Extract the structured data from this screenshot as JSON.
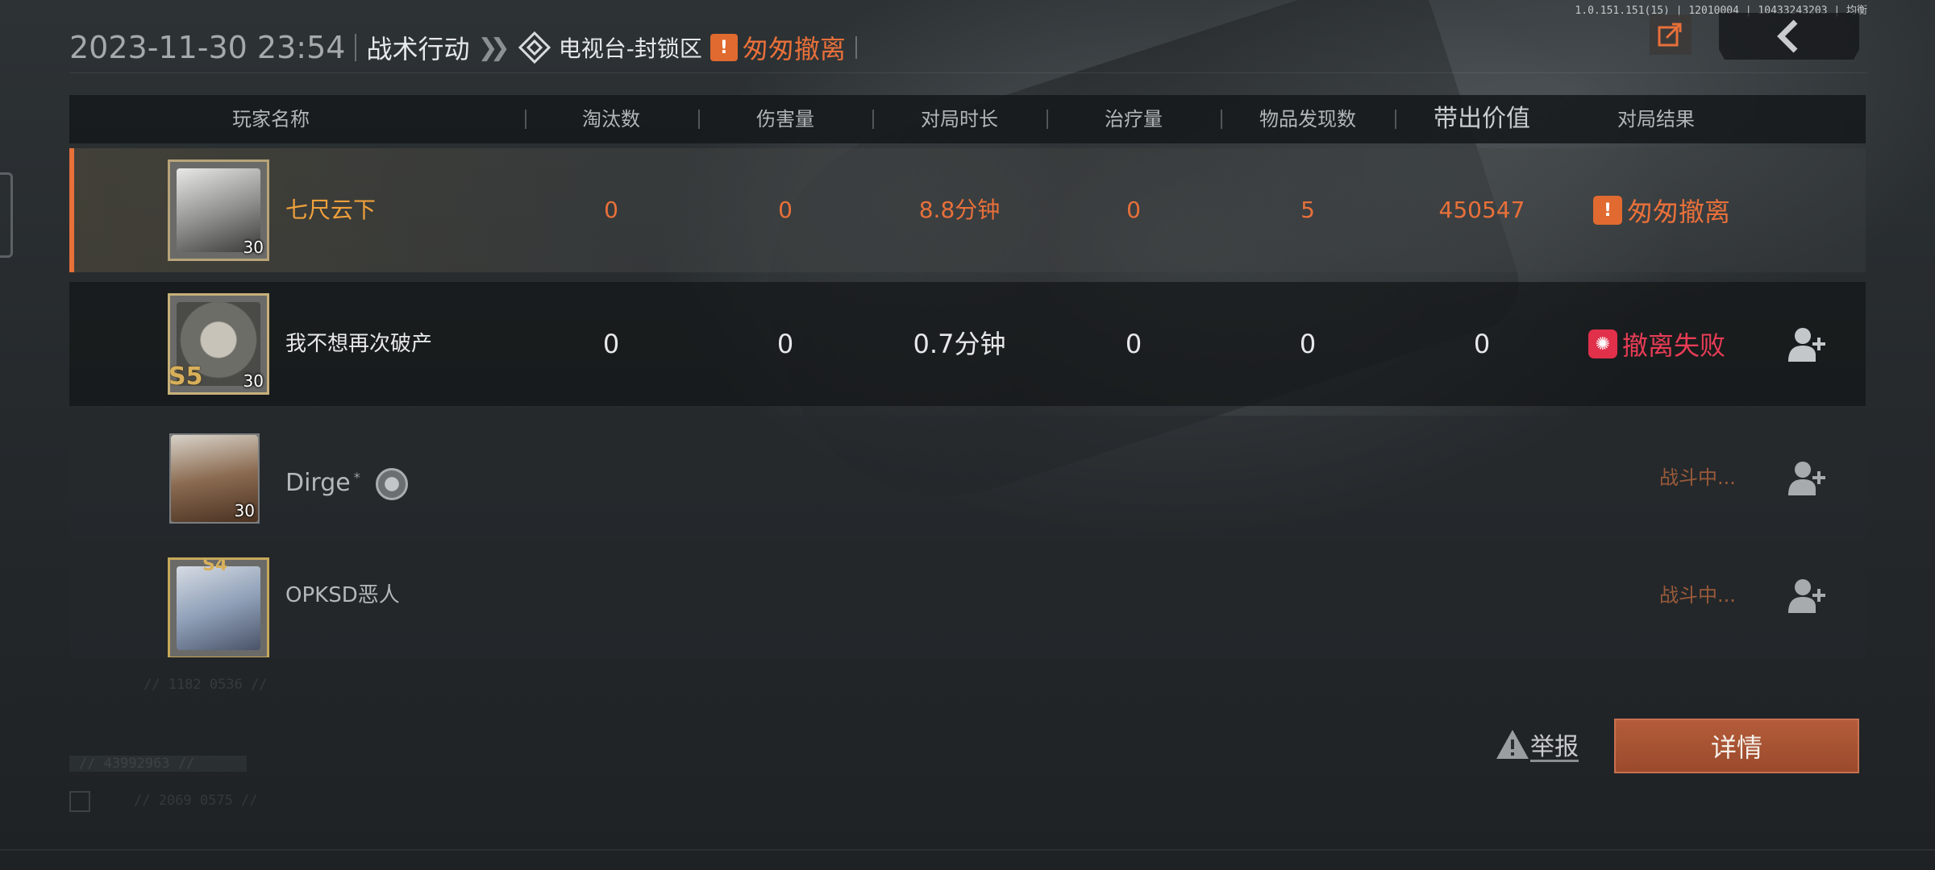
{
  "debug": "1.0.151.151(15) | 12010004 | 10433243203 | 均衡",
  "header": {
    "datetime": "2023-11-30 23:54",
    "mode": "战术行动",
    "chevrons": "❯❯",
    "map": "电视台-封锁区",
    "result": "匆匆撤离"
  },
  "columns": {
    "name": "玩家名称",
    "kills": "淘汰数",
    "damage": "伤害量",
    "duration": "对局时长",
    "healing": "治疗量",
    "items": "物品发现数",
    "value": "带出价值",
    "result": "对局结果"
  },
  "players": [
    {
      "name": "七尺云下",
      "level": "30",
      "kills": "0",
      "damage": "0",
      "duration": "8.8分钟",
      "healing": "0",
      "items": "5",
      "value": "450547",
      "result": "匆匆撤离"
    },
    {
      "name": "我不想再次破产",
      "level": "30",
      "badge": "S5",
      "kills": "0",
      "damage": "0",
      "duration": "0.7分钟",
      "healing": "0",
      "items": "0",
      "value": "0",
      "result": "撤离失败"
    },
    {
      "name": "Dirge",
      "online_mark": "*",
      "level": "30",
      "status": "战斗中..."
    },
    {
      "name": "OPKSD恶人",
      "badge": "S4",
      "status": "战斗中..."
    }
  ],
  "footer": {
    "coords": "// 1182 0536 //",
    "id_text": "// 43992963 //",
    "code": "//  2069 0575 //",
    "report_label": "举报",
    "detail_label": "详情"
  },
  "icons": [
    "map-diamond-icon",
    "warning-icon",
    "share-icon",
    "back-arrow-icon",
    "fail-icon",
    "add-friend-icon",
    "emblem-icon"
  ],
  "colors": {
    "accent_orange": "#e8703a",
    "fail_red": "#e83c55",
    "self_name": "#f0a03c",
    "detail_button": "#a9533a"
  }
}
